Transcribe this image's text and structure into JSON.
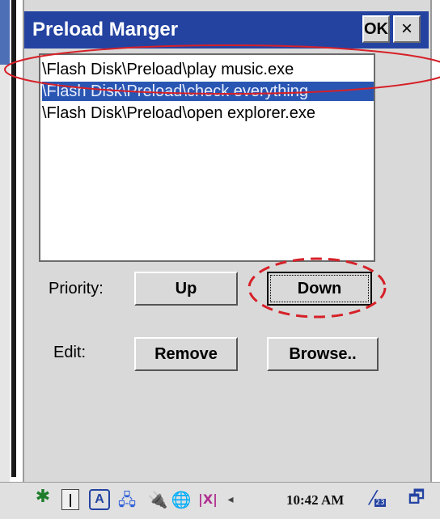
{
  "window": {
    "title": "Preload Manger",
    "ok_label": "OK",
    "close_label": "×"
  },
  "list": {
    "items": [
      {
        "path": "\\Flash Disk\\Preload\\play music.exe",
        "selected": false
      },
      {
        "path": "\\Flash Disk\\Preload\\check everything",
        "selected": true
      },
      {
        "path": "\\Flash Disk\\Preload\\open explorer.exe",
        "selected": false
      }
    ]
  },
  "priority": {
    "label": "Priority:",
    "up_label": "Up",
    "down_label": "Down"
  },
  "edit": {
    "label": "Edit:",
    "remove_label": "Remove",
    "browse_label": "Browse.."
  },
  "taskbar": {
    "time": "10:42 AM",
    "input_mode": "A",
    "battery_badge": "23"
  },
  "colors": {
    "titlebar": "#2443a1",
    "selection": "#2a56b3",
    "annotation": "#d62028"
  }
}
